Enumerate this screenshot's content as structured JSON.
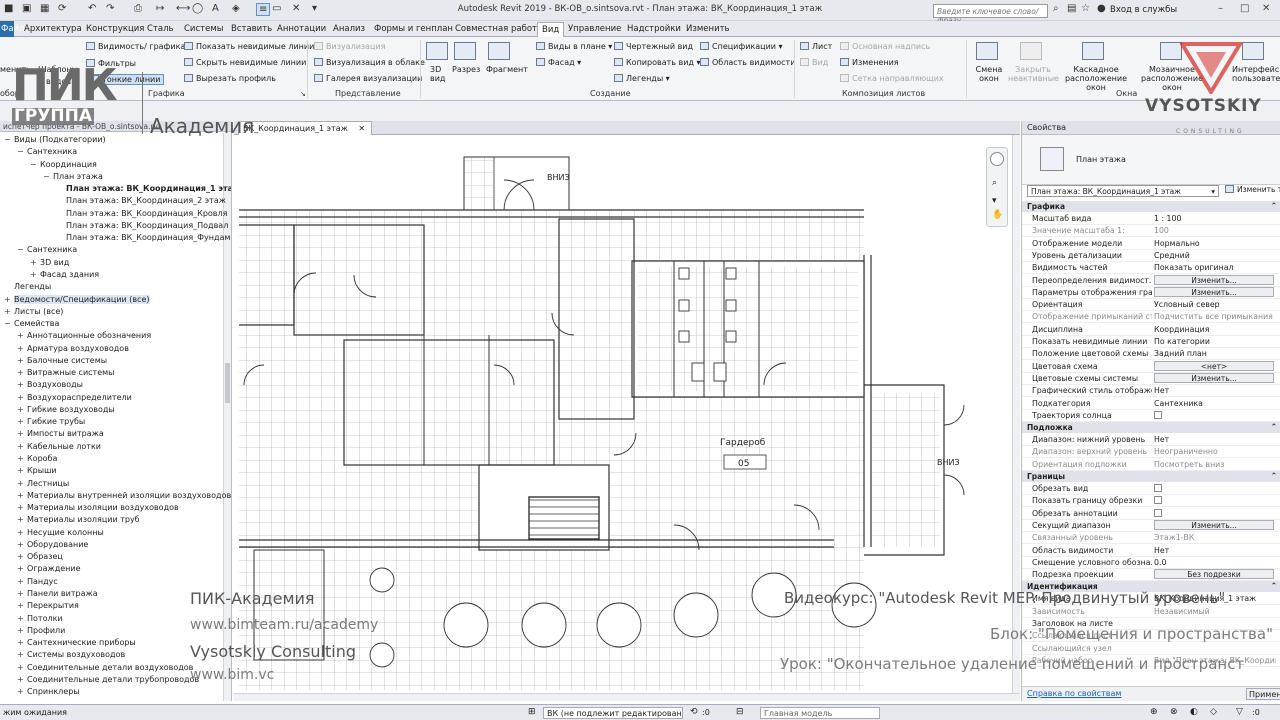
{
  "window": {
    "title": "Autodesk Revit 2019 - ВК-OB_o.sintsova.rvt - План этажа: ВК_Координация_1 этаж",
    "search_placeholder": "Введите ключевое слово/фразу",
    "login": "Вход в службы"
  },
  "ribbon_tabs": [
    "Файл",
    "Архитектура",
    "Конструкция",
    "Сталь",
    "Системы",
    "Вставить",
    "Аннотации",
    "Анализ",
    "Формы и генплан",
    "Совместная работа",
    "Вид",
    "Управление",
    "Надстройки",
    "Изменить"
  ],
  "ribbon": {
    "graphics": {
      "items": [
        "Видимость/ графика",
        "Фильтры",
        "Тонкие линии",
        "Показать невидимые линии",
        "Скрыть невидимые линии",
        "Вырезать профиль"
      ],
      "left_partial": [
        "менить",
        "Шаблоны",
        "видов",
        "обор"
      ],
      "panel": "Графика"
    },
    "presentation": {
      "items": [
        "Визуализация",
        "Визуализация в облаке",
        "Галерея визуализации"
      ],
      "panel": "Представление"
    },
    "create": {
      "big": [
        "3D вид",
        "Разрез",
        "Фрагмент"
      ],
      "items": [
        "Виды в плане",
        "Фасад",
        "Копировать вид",
        "Легенды",
        "Чертежный вид",
        "Спецификации",
        "Область видимости"
      ],
      "panel": "Создание"
    },
    "sheet": {
      "items": [
        "Лист",
        "Вид",
        "Основная надпись",
        "Изменения",
        "Сетка направляющих"
      ],
      "panel": "Композиция листов"
    },
    "windows": {
      "items": [
        "Смена окон",
        "Закрыть неактивные",
        "Каскадное расположение окон",
        "Мозаичное расположение окон",
        "Интерфейс пользователя"
      ],
      "panel": "Окна"
    }
  },
  "project_browser": {
    "header": "испетчер проекта - ВК-ОВ_о.sintsova.rvt",
    "items": [
      {
        "label": "Виды (Подкатегории)",
        "level": 0,
        "toggle": "-"
      },
      {
        "label": "Сантехника",
        "level": 1,
        "toggle": "-"
      },
      {
        "label": "Координация",
        "level": 2,
        "toggle": "-"
      },
      {
        "label": "План этажа",
        "level": 3,
        "toggle": "-"
      },
      {
        "label": "План этажа: ВК_Координация_1 этаж",
        "level": 4,
        "bold": true
      },
      {
        "label": "План этажа: ВК_Координация_2 этаж",
        "level": 4
      },
      {
        "label": "План этажа: ВК_Координация_Кровля",
        "level": 4
      },
      {
        "label": "План этажа: ВК_Координация_Подвал",
        "level": 4
      },
      {
        "label": "План этажа: ВК_Координация_Фундамент",
        "level": 4
      },
      {
        "label": "Сантехника",
        "level": 1,
        "toggle": "-"
      },
      {
        "label": "3D вид",
        "level": 2,
        "toggle": "+"
      },
      {
        "label": "Фасад здания",
        "level": 2,
        "toggle": "+"
      },
      {
        "label": "Легенды",
        "level": 0,
        "toggle": ""
      },
      {
        "label": "Ведомости/Спецификации (все)",
        "level": 0,
        "toggle": "+",
        "selected": true
      },
      {
        "label": "Листы (все)",
        "level": 0,
        "toggle": "+"
      },
      {
        "label": "Семейства",
        "level": 0,
        "toggle": "-"
      },
      {
        "label": "Аннотационные обозначения",
        "level": 1,
        "toggle": "+"
      },
      {
        "label": "Арматура воздуховодов",
        "level": 1,
        "toggle": "+"
      },
      {
        "label": "Балочные системы",
        "level": 1,
        "toggle": "+"
      },
      {
        "label": "Витражные системы",
        "level": 1,
        "toggle": "+"
      },
      {
        "label": "Воздуховоды",
        "level": 1,
        "toggle": "+"
      },
      {
        "label": "Воздухораспределители",
        "level": 1,
        "toggle": "+"
      },
      {
        "label": "Гибкие воздуховоды",
        "level": 1,
        "toggle": "+"
      },
      {
        "label": "Гибкие трубы",
        "level": 1,
        "toggle": "+"
      },
      {
        "label": "Импосты витража",
        "level": 1,
        "toggle": "+"
      },
      {
        "label": "Кабельные лотки",
        "level": 1,
        "toggle": "+"
      },
      {
        "label": "Короба",
        "level": 1,
        "toggle": "+"
      },
      {
        "label": "Крыши",
        "level": 1,
        "toggle": "+"
      },
      {
        "label": "Лестницы",
        "level": 1,
        "toggle": "+"
      },
      {
        "label": "Материалы внутренней изоляции воздуховодов",
        "level": 1,
        "toggle": "+"
      },
      {
        "label": "Материалы изоляции воздуховодов",
        "level": 1,
        "toggle": "+"
      },
      {
        "label": "Материалы изоляции труб",
        "level": 1,
        "toggle": "+"
      },
      {
        "label": "Несущие колонны",
        "level": 1,
        "toggle": "+"
      },
      {
        "label": "Оборудование",
        "level": 1,
        "toggle": "+"
      },
      {
        "label": "Образец",
        "level": 1,
        "toggle": "+"
      },
      {
        "label": "Ограждение",
        "level": 1,
        "toggle": "+"
      },
      {
        "label": "Пандус",
        "level": 1,
        "toggle": "+"
      },
      {
        "label": "Панели витража",
        "level": 1,
        "toggle": "+"
      },
      {
        "label": "Перекрытия",
        "level": 1,
        "toggle": "+"
      },
      {
        "label": "Потолки",
        "level": 1,
        "toggle": "+"
      },
      {
        "label": "Профили",
        "level": 1,
        "toggle": "+"
      },
      {
        "label": "Сантехнические приборы",
        "level": 1,
        "toggle": "+"
      },
      {
        "label": "Системы воздуховодов",
        "level": 1,
        "toggle": "+"
      },
      {
        "label": "Соединительные детали воздуховодов",
        "level": 1,
        "toggle": "+"
      },
      {
        "label": "Соединительные детали трубопроводов",
        "level": 1,
        "toggle": "+"
      },
      {
        "label": "Спринклеры",
        "level": 1,
        "toggle": "+"
      }
    ]
  },
  "view_tab": {
    "label": "ВК_Координация_1 этаж"
  },
  "drawing": {
    "labels": {
      "down_top": "ВНИЗ",
      "down_right": "ВНИЗ",
      "room_name": "Гардероб",
      "room_number": "05"
    }
  },
  "properties": {
    "header": "Свойства",
    "type_name": "План этажа",
    "selector": "План этажа: ВК_Координация_1 этаж",
    "edit_type": "Изменить т",
    "groups": [
      {
        "name": "Графика",
        "rows": [
          {
            "label": "Масштаб вида",
            "value": "1 : 100"
          },
          {
            "label": "Значение масштаба    1:",
            "value": "100",
            "disabled": true
          },
          {
            "label": "Отображение модели",
            "value": "Нормально"
          },
          {
            "label": "Уровень детализации",
            "value": "Средний"
          },
          {
            "label": "Видимость частей",
            "value": "Показать оригинал"
          },
          {
            "label": "Переопределения видимост...",
            "value": "Изменить...",
            "button": true
          },
          {
            "label": "Параметры отображения гра...",
            "value": "Изменить...",
            "button": true
          },
          {
            "label": "Ориентация",
            "value": "Условный север"
          },
          {
            "label": "Отображение примыканий ст...",
            "value": "Подчистить все примыкания ...",
            "disabled": true
          },
          {
            "label": "Дисциплина",
            "value": "Координация"
          },
          {
            "label": "Показать невидимые линии",
            "value": "По категории"
          },
          {
            "label": "Положение цветовой схемы",
            "value": "Задний план"
          },
          {
            "label": "Цветовая схема",
            "value": "<нет>",
            "button": true
          },
          {
            "label": "Цветовые схемы системы",
            "value": "Изменить...",
            "button": true
          },
          {
            "label": "Графический стиль отображе...",
            "value": "Нет"
          },
          {
            "label": "Подкатегория",
            "value": "Сантехника"
          },
          {
            "label": "Траектория солнца",
            "value": "",
            "checkbox": true
          }
        ]
      },
      {
        "name": "Подложка",
        "rows": [
          {
            "label": "Диапазон: нижний уровень",
            "value": "Нет"
          },
          {
            "label": "Диапазон: верхний уровень",
            "value": "Неограниченно",
            "disabled": true
          },
          {
            "label": "Ориентация подложки",
            "value": "Посмотреть вниз",
            "disabled": true
          }
        ]
      },
      {
        "name": "Границы",
        "rows": [
          {
            "label": "Обрезать вид",
            "value": "",
            "checkbox": true
          },
          {
            "label": "Показать границу обрезки",
            "value": "",
            "checkbox": true
          },
          {
            "label": "Обрезать аннотации",
            "value": "",
            "checkbox": true
          },
          {
            "label": "Секущий диапазон",
            "value": "Изменить...",
            "button": true
          },
          {
            "label": "Связанный уровень",
            "value": "Этаж1-ВК",
            "disabled": true
          },
          {
            "label": "Область видимости",
            "value": "Нет"
          },
          {
            "label": "Смещение условного обозна...",
            "value": "0.0"
          },
          {
            "label": "Подрезка проекции",
            "value": "Без подрезки",
            "button": true
          }
        ]
      },
      {
        "name": "Идентификация",
        "rows": [
          {
            "label": "Имя вида",
            "value": "ВК_Координация_1 этаж"
          },
          {
            "label": "Зависимость",
            "value": "Независимый",
            "disabled": true
          },
          {
            "label": "Заголовок на листе",
            "value": ""
          },
          {
            "label": "Ссылающийся лист",
            "value": "",
            "disabled": true
          },
          {
            "label": "Ссылающийся узел",
            "value": "",
            "disabled": true
          },
          {
            "label": "Рабочий набор",
            "value": "Вид \"План этажа: ВК_Координ",
            "disabled": true
          }
        ]
      }
    ],
    "help_link": "Справка по свойствам",
    "apply": "Примен"
  },
  "statusbar": {
    "left": "жим ожидания",
    "workset": "ВК (не подлежит редактирован",
    "count": ":0",
    "model": "Главная модель"
  },
  "overlay": {
    "logo_main": "ПИК",
    "logo_sub": "ГРУППА",
    "logo_academy": "Академия",
    "brand_right": "VYSOTSKIY",
    "brand_right_sub": "CONSULTING",
    "academy": "ПИК-Академия",
    "academy_url": "www.bimteam.ru/academy",
    "consulting": "Vysotskiy Consulting",
    "consulting_url": "www.bim.vc",
    "course": "Видеокурс: \"Autodesk Revit MEP. Продвинутый уровень\"",
    "block": "Блок: \"Помещения и пространства\"",
    "lesson": "Урок: \"Окончательное удаление помещений и пространст"
  },
  "colors": {
    "accent": "#2e6ea8",
    "brand_red": "#d7302b",
    "panel_bg": "#f4f5f7",
    "chrome_bg": "#e6e9ee"
  }
}
